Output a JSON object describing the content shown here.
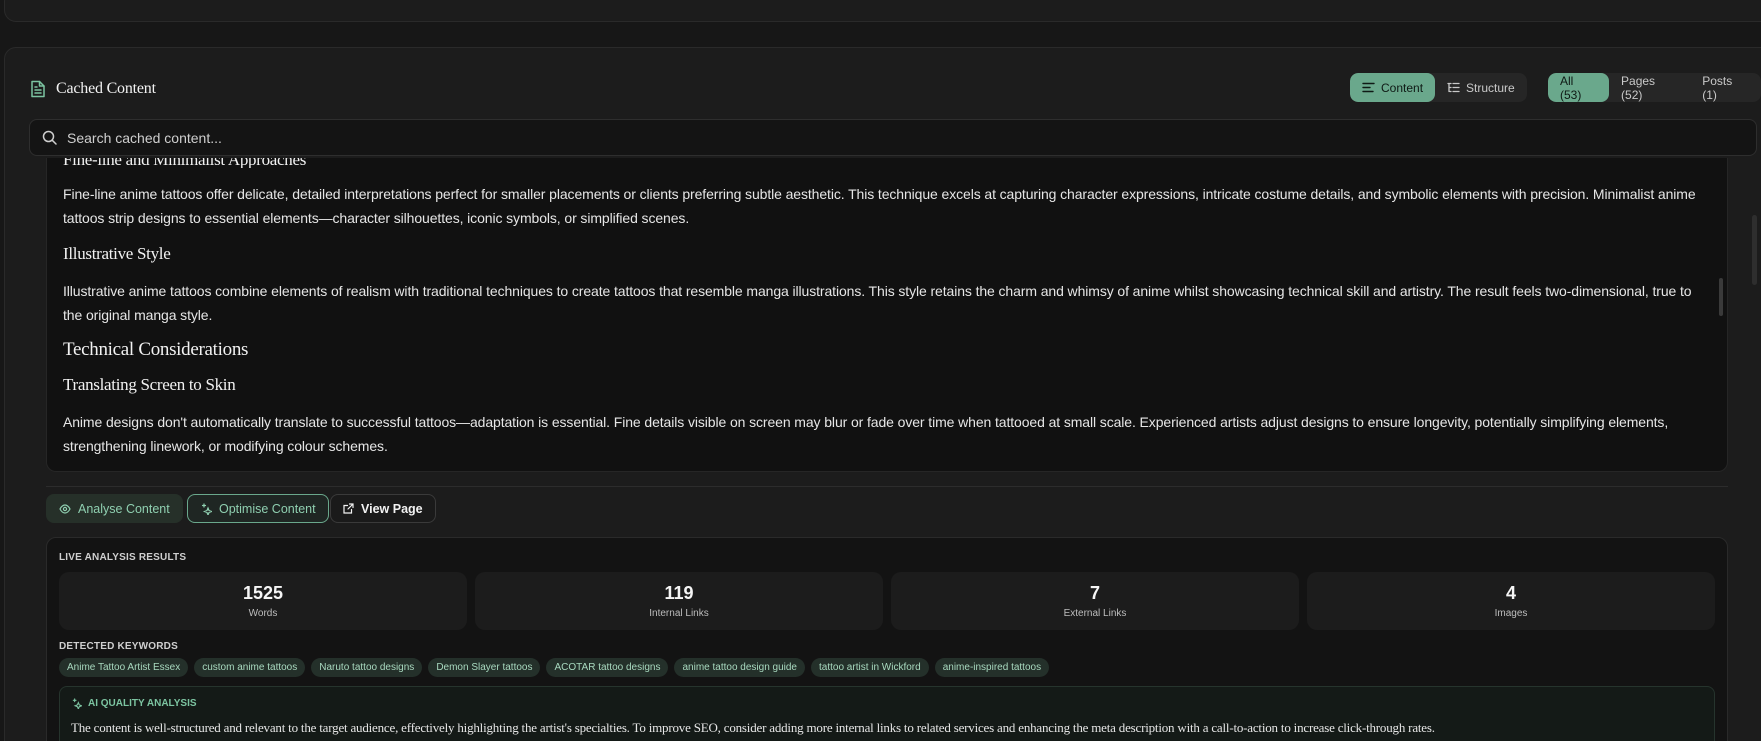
{
  "header": {
    "title": "Cached Content"
  },
  "view_toggle": {
    "content_label": "Content",
    "structure_label": "Structure"
  },
  "filter": {
    "all_label": "All (53)",
    "pages_label": "Pages (52)",
    "posts_label": "Posts (1)"
  },
  "search": {
    "placeholder": "Search cached content..."
  },
  "content": {
    "h_fine": "Fine-line and Minimalist Approaches",
    "p_fine": "Fine-line anime tattoos offer delicate, detailed interpretations perfect for smaller placements or clients preferring subtle aesthetic. This technique excels at capturing character expressions, intricate costume details, and symbolic elements with precision. Minimalist anime tattoos strip designs to essential elements—character silhouettes, iconic symbols, or simplified scenes.",
    "h_illustrative": "Illustrative Style",
    "p_illustrative": "Illustrative anime tattoos combine elements of realism with traditional techniques to create tattoos that resemble manga illustrations. This style retains the charm and whimsy of anime whilst showcasing technical skill and artistry. The result feels two-dimensional, true to the original manga style.",
    "h_technical": "Technical Considerations",
    "h_translating": "Translating Screen to Skin",
    "p_translating": "Anime designs don't automatically translate to successful tattoos—adaptation is essential. Fine details visible on screen may blur or fade over time when tattooed at small scale. Experienced artists adjust designs to ensure longevity, potentially simplifying elements, strengthening linework, or modifying colour schemes."
  },
  "actions": {
    "analyse_label": "Analyse Content",
    "optimise_label": "Optimise Content",
    "view_label": "View Page"
  },
  "analysis": {
    "title": "LIVE ANALYSIS RESULTS",
    "stats": [
      {
        "value": "1525",
        "label": "Words"
      },
      {
        "value": "119",
        "label": "Internal Links"
      },
      {
        "value": "7",
        "label": "External Links"
      },
      {
        "value": "4",
        "label": "Images"
      }
    ],
    "keywords_title": "DETECTED KEYWORDS",
    "keywords": [
      "Anime Tattoo Artist Essex",
      "custom anime tattoos",
      "Naruto tattoo designs",
      "Demon Slayer tattoos",
      "ACOTAR tattoo designs",
      "anime tattoo design guide",
      "tattoo artist in Wickford",
      "anime-inspired tattoos"
    ],
    "ai_title": "AI QUALITY ANALYSIS",
    "ai_text": "The content is well-structured and relevant to the target audience, effectively highlighting the artist's specialties. To improve SEO, consider adding more internal links to related services and enhancing the meta description with a call-to-action to increase click-through rates."
  },
  "colors": {
    "accent": "#6aa88c",
    "background": "#171717",
    "panel": "#1c1c1c"
  }
}
